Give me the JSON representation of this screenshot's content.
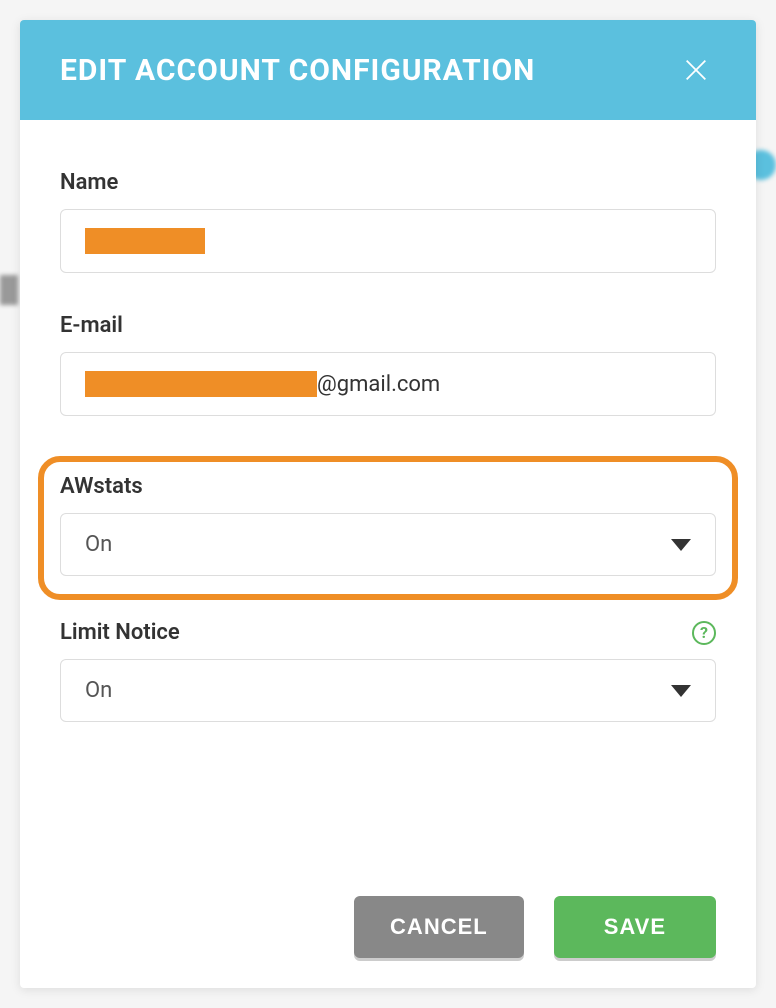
{
  "modal": {
    "title": "EDIT ACCOUNT CONFIGURATION"
  },
  "form": {
    "name": {
      "label": "Name",
      "value": ""
    },
    "email": {
      "label": "E-mail",
      "domain": "@gmail.com"
    },
    "awstats": {
      "label": "AWstats",
      "value": "On"
    },
    "limitNotice": {
      "label": "Limit Notice",
      "value": "On"
    }
  },
  "buttons": {
    "cancel": "CANCEL",
    "save": "SAVE"
  }
}
